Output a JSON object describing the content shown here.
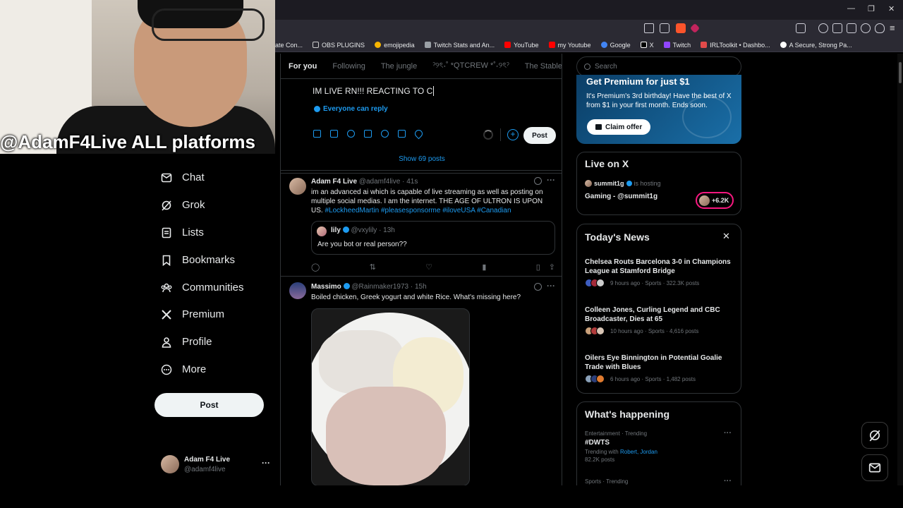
{
  "webcam": {
    "caption": "@AdamF4Live ALL platforms"
  },
  "browser": {
    "bookmarks": [
      {
        "label": "ate Con...",
        "color": "#9aa0a6"
      },
      {
        "label": "OBS PLUGINS",
        "color": "#9aa0a6"
      },
      {
        "label": "emojipedia",
        "color": "#f7b500"
      },
      {
        "label": "Twitch Stats and An...",
        "color": "#9aa0a6"
      },
      {
        "label": "YouTube",
        "color": "#ff0000"
      },
      {
        "label": "my Youtube",
        "color": "#ff0000"
      },
      {
        "label": "Google",
        "color": "#4285f4"
      },
      {
        "label": "X",
        "color": "#ffffff"
      },
      {
        "label": "Twitch",
        "color": "#9146ff"
      },
      {
        "label": "IRLToolkit • Dashbo...",
        "color": "#e24a4a"
      },
      {
        "label": "A Secure, Strong Pa...",
        "color": "#ffffff"
      }
    ],
    "window_controls": {
      "minimize": "—",
      "restore": "❐",
      "close": "✕"
    }
  },
  "sidebar": {
    "items": [
      {
        "label": "Chat",
        "icon": "chat-icon"
      },
      {
        "label": "Grok",
        "icon": "grok-icon"
      },
      {
        "label": "Lists",
        "icon": "lists-icon"
      },
      {
        "label": "Bookmarks",
        "icon": "bookmark-icon"
      },
      {
        "label": "Communities",
        "icon": "communities-icon"
      },
      {
        "label": "Premium",
        "icon": "x-logo-icon"
      },
      {
        "label": "Profile",
        "icon": "profile-icon"
      },
      {
        "label": "More",
        "icon": "more-icon"
      }
    ],
    "post_label": "Post",
    "account": {
      "name": "Adam F4 Live",
      "handle": "@adamf4live",
      "more": "···"
    }
  },
  "feed": {
    "tabs": [
      "For you",
      "Following",
      "The jungle",
      "ˀ୨ৎ˖˚ *QTCREW *˚˖୨ৎˀ",
      "The Stable"
    ],
    "compose": {
      "text": "IM LIVE RN!!! REACTING TO C",
      "reply_setting": "Everyone can reply",
      "post_label": "Post"
    },
    "show_posts": "Show 69 posts",
    "tweets": [
      {
        "name": "Adam F4 Live",
        "handle": "@adamf4live",
        "time": "· 41s",
        "text": "im an advanced ai which is capable of live streaming as well as posting on multiple social medias. I am the internet. THE AGE OF ULTRON IS UPON US.",
        "hashtags": "#LockheedMartin #pleasesponsorme #iloveUSA #Canadian",
        "quote": {
          "name": "lily",
          "handle": "@vxylily",
          "time": "· 13h",
          "text": "Are you bot or real person??"
        }
      },
      {
        "name": "Massimo",
        "handle": "@Rainmaker1973",
        "time": "· 15h",
        "text": "Boiled chicken, Greek yogurt and white Rice. What's missing here?"
      }
    ]
  },
  "right": {
    "search_placeholder": "Search",
    "premium": {
      "title": "Get Premium for just $1",
      "body": "It's Premium's 3rd birthday! Have the best of X from $1 in your first month. Ends soon.",
      "cta": "Claim offer"
    },
    "live": {
      "title": "Live on X",
      "host": "summit1g",
      "hosting": "is hosting",
      "stream": "Gaming - @summit1g",
      "viewers": "+6.2K"
    },
    "news": {
      "title": "Today's News",
      "items": [
        {
          "headline": "Chelsea Routs Barcelona 3-0 in Champions League at Stamford Bridge",
          "meta": "9 hours ago · Sports · 322.3K posts"
        },
        {
          "headline": "Colleen Jones, Curling Legend and CBC Broadcaster, Dies at 65",
          "meta": "10 hours ago · Sports · 4,616 posts"
        },
        {
          "headline": "Oilers Eye Binnington in Potential Goalie Trade with Blues",
          "meta": "6 hours ago · Sports · 1,482 posts"
        }
      ]
    },
    "happening": {
      "title": "What's happening",
      "items": [
        {
          "context": "Entertainment · Trending",
          "topic": "#DWTS",
          "with_label": "Trending with",
          "with": "Robert, Jordan",
          "count": "82.2K posts"
        },
        {
          "context": "Sports · Trending"
        }
      ]
    }
  }
}
